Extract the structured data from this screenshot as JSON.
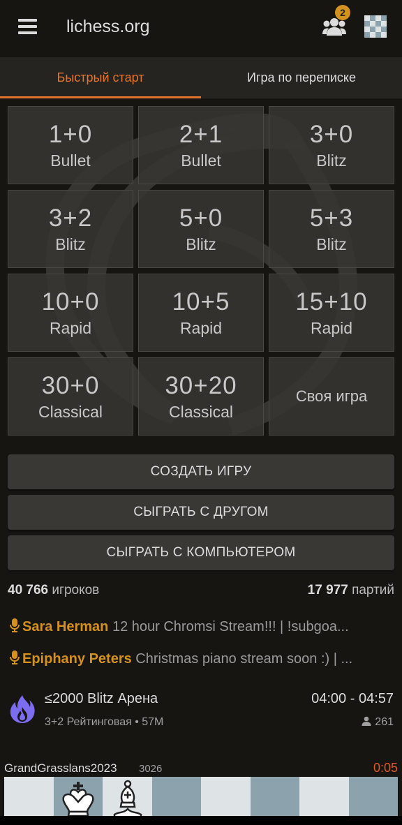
{
  "header": {
    "title": "lichess.org",
    "menu_icon": "hamburger-icon",
    "friends_icon": "friends-icon",
    "friends_count": "2",
    "board_icon": "board-icon"
  },
  "tabs": [
    {
      "label": "Быстрый старт",
      "active": true
    },
    {
      "label": "Игра по переписке",
      "active": false
    }
  ],
  "quick_pairing": [
    {
      "clock": "1+0",
      "perf": "Bullet"
    },
    {
      "clock": "2+1",
      "perf": "Bullet"
    },
    {
      "clock": "3+0",
      "perf": "Blitz"
    },
    {
      "clock": "3+2",
      "perf": "Blitz"
    },
    {
      "clock": "5+0",
      "perf": "Blitz"
    },
    {
      "clock": "5+3",
      "perf": "Blitz"
    },
    {
      "clock": "10+0",
      "perf": "Rapid"
    },
    {
      "clock": "10+5",
      "perf": "Rapid"
    },
    {
      "clock": "15+10",
      "perf": "Rapid"
    },
    {
      "clock": "30+0",
      "perf": "Classical"
    },
    {
      "clock": "30+20",
      "perf": "Classical"
    },
    {
      "custom": "Своя игра"
    }
  ],
  "actions": {
    "create_game": "СОЗДАТЬ ИГРУ",
    "play_friend": "СЫГРАТЬ С ДРУГОМ",
    "play_computer": "СЫГРАТЬ С КОМПЬЮТЕРОМ"
  },
  "stats": {
    "players_count": "40 766",
    "players_label": "игроков",
    "games_count": "17 977",
    "games_label": "партий"
  },
  "streams": [
    {
      "streamer": "Sara Herman",
      "title": "12 hour Chromsi Stream!!! | !subgoa..."
    },
    {
      "streamer": "Epiphany Peters",
      "title": "Christmas piano stream soon :) | ..."
    }
  ],
  "tournament": {
    "name": "≤2000 Blitz Арена",
    "info": "3+2 Рейтинговая • 57M",
    "time": "04:00 - 04:57",
    "players": "261",
    "icon": "flame-icon"
  },
  "featured": {
    "player": "GrandGrasslans2023",
    "rating": "3026",
    "clock": "0:05"
  },
  "colors": {
    "accent": "#e6742c",
    "streamer": "#d59120",
    "clock_low": "#e05a23",
    "background": "#161512"
  }
}
